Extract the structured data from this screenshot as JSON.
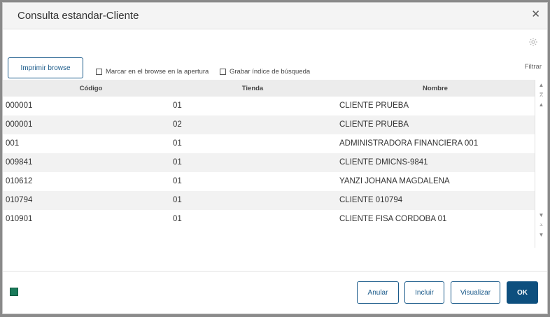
{
  "dialog": {
    "title": "Consulta estandar-Cliente",
    "close_icon": "close-icon",
    "settings_icon": "gear-icon"
  },
  "toolbar": {
    "print_label": "Imprimir browse",
    "check_mark_label": "Marcar en el browse en la apertura",
    "check_mark_checked": false,
    "check_index_label": "Grabar índice de búsqueda",
    "check_index_checked": false,
    "filter_label": "Filtrar"
  },
  "table": {
    "columns": [
      "Código",
      "Tienda",
      "Nombre"
    ],
    "rows": [
      {
        "codigo": "000001",
        "tienda": "01",
        "nombre": "CLIENTE PRUEBA"
      },
      {
        "codigo": "000001",
        "tienda": "02",
        "nombre": "CLIENTE PRUEBA"
      },
      {
        "codigo": "001",
        "tienda": "01",
        "nombre": "ADMINISTRADORA FINANCIERA 001"
      },
      {
        "codigo": "009841",
        "tienda": "01",
        "nombre": "CLIENTE DMICNS-9841"
      },
      {
        "codigo": "010612",
        "tienda": "01",
        "nombre": "YANZI JOHANA MAGDALENA"
      },
      {
        "codigo": "010794",
        "tienda": "01",
        "nombre": "CLIENTE 010794"
      },
      {
        "codigo": "010901",
        "tienda": "01",
        "nombre": "CLIENTE FISA CORDOBA 01"
      }
    ]
  },
  "footer": {
    "anular_label": "Anular",
    "incluir_label": "Incluir",
    "visualizar_label": "Visualizar",
    "ok_label": "OK"
  },
  "colors": {
    "primary": "#0d4f7e",
    "header_bg": "#ececec",
    "row_alt_bg": "#f2f2f2"
  }
}
